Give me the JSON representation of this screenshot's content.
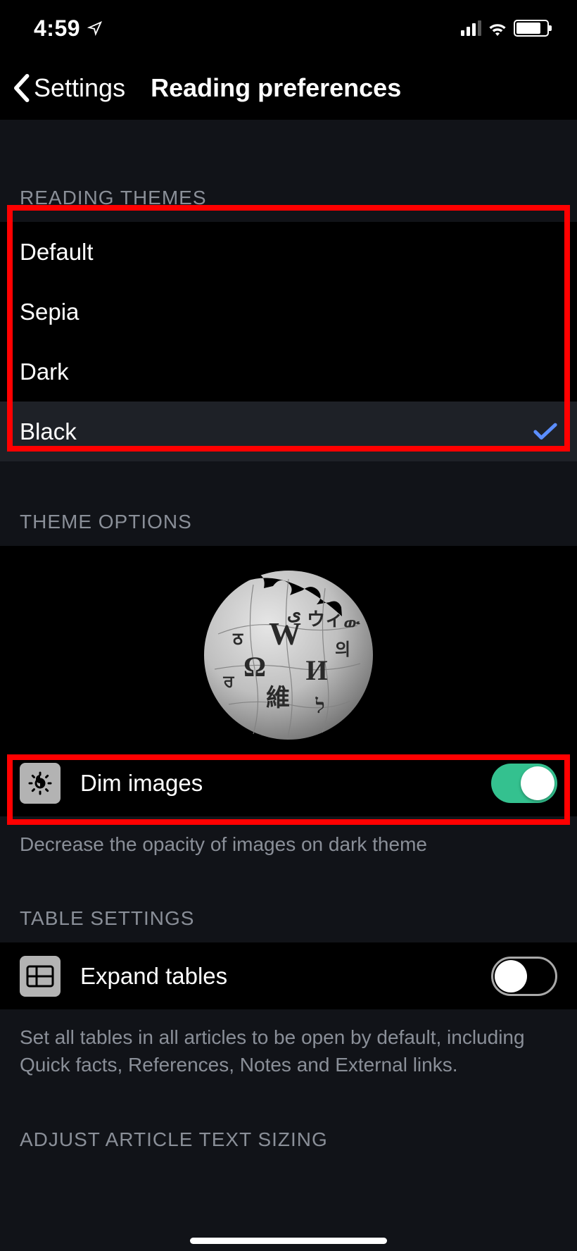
{
  "status": {
    "time": "4:59"
  },
  "nav": {
    "back_label": "Settings",
    "title": "Reading preferences"
  },
  "sections": {
    "reading_themes_header": "READING THEMES",
    "theme_options_header": "THEME OPTIONS",
    "table_settings_header": "TABLE SETTINGS",
    "adjust_text_header": "ADJUST ARTICLE TEXT SIZING"
  },
  "themes": {
    "items": [
      {
        "label": "Default",
        "selected": false
      },
      {
        "label": "Sepia",
        "selected": false
      },
      {
        "label": "Dark",
        "selected": false
      },
      {
        "label": "Black",
        "selected": true
      }
    ]
  },
  "dim_images": {
    "label": "Dim images",
    "description": "Decrease the opacity of images on dark theme",
    "enabled": true
  },
  "expand_tables": {
    "label": "Expand tables",
    "description": "Set all tables in all articles to be open by default, including Quick facts, References, Notes and External links.",
    "enabled": false
  }
}
